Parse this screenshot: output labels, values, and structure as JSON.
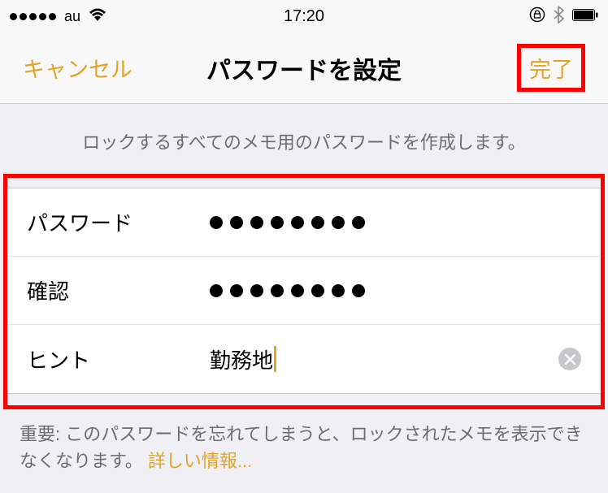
{
  "status": {
    "carrier": "au",
    "time": "17:20"
  },
  "nav": {
    "cancel": "キャンセル",
    "title": "パスワードを設定",
    "done": "完了"
  },
  "description": "ロックするすべてのメモ用のパスワードを作成します。",
  "fields": {
    "password_label": "パスワード",
    "confirm_label": "確認",
    "hint_label": "ヒント",
    "hint_value": "勤務地",
    "password_length": 8,
    "confirm_length": 8
  },
  "footer": {
    "note_prefix": "重要: このパスワードを忘れてしまうと、ロックされたメモを表示できなくなります。 ",
    "link": "詳しい情報..."
  }
}
